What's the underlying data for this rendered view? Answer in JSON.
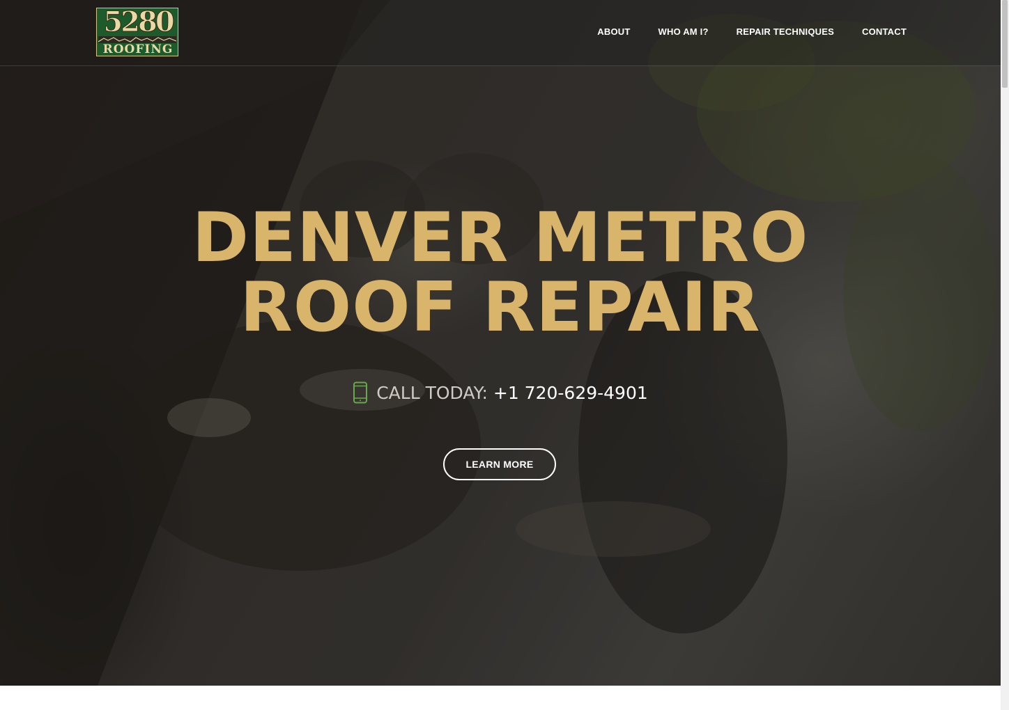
{
  "brand": {
    "logo_numbers": "5280",
    "logo_word": "ROOFING",
    "colors": {
      "logo_green": "#1d5a2c",
      "logo_cream": "#e9d9a6",
      "headline_gold": "#d9b46b",
      "phone_icon_green": "#6aa84f"
    }
  },
  "nav": {
    "items": [
      {
        "label": "ABOUT"
      },
      {
        "label": "WHO AM I?"
      },
      {
        "label": "REPAIR TECHNIQUES"
      },
      {
        "label": "CONTACT"
      }
    ]
  },
  "hero": {
    "headline_line1": "DENVER METRO",
    "headline_line2": "ROOF REPAIR",
    "call_label": "CALL TODAY:",
    "call_number": "+1 720-629-4901",
    "phone_icon": "mobile-phone-icon",
    "cta_label": "LEARN MORE"
  }
}
